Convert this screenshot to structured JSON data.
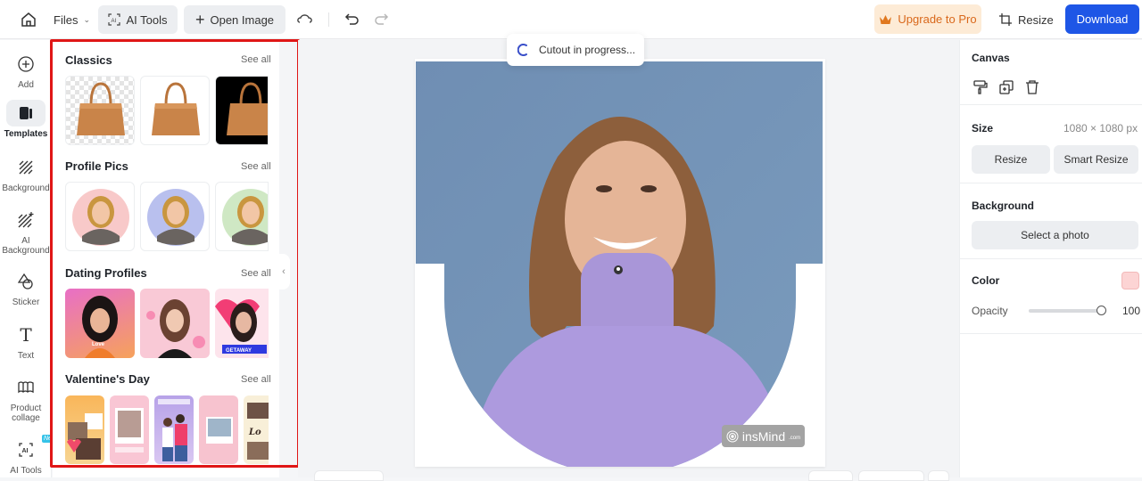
{
  "topbar": {
    "files_label": "Files",
    "ai_tools_label": "AI Tools",
    "open_image_label": "Open Image",
    "upgrade_label": "Upgrade to Pro",
    "resize_label": "Resize",
    "download_label": "Download",
    "colors": {
      "accent": "#1e56e6",
      "upgrade_bg": "#fdebd6",
      "upgrade_text": "#d9681b"
    }
  },
  "rail": {
    "items": [
      {
        "label": "Add",
        "icon": "plus-circle-icon"
      },
      {
        "label": "Templates",
        "icon": "templates-icon",
        "active": true
      },
      {
        "label": "Background",
        "icon": "background-icon"
      },
      {
        "label": "AI Background",
        "icon": "ai-background-icon"
      },
      {
        "label": "Sticker",
        "icon": "sticker-icon"
      },
      {
        "label": "Text",
        "icon": "text-icon"
      },
      {
        "label": "Product collage",
        "icon": "collage-icon"
      },
      {
        "label": "AI Tools",
        "icon": "ai-tools-icon",
        "badge": "New"
      }
    ]
  },
  "templates": {
    "see_all_label": "See all",
    "sections": [
      {
        "title": "Classics",
        "thumbs": [
          "Bag on transparent background",
          "Bag on white background",
          "Bag on black background"
        ]
      },
      {
        "title": "Profile Pics",
        "thumbs": [
          "Portrait on pink circle",
          "Portrait on blue circle",
          "Portrait on green circle"
        ]
      },
      {
        "title": "Dating Profiles",
        "thumbs": [
          "Love profile",
          "Hearts profile",
          "Romantic Getaway profile"
        ],
        "thumb_texts": [
          "Love",
          "",
          "GETAWAY"
        ]
      },
      {
        "title": "Valentine's Day",
        "thumbs": [
          "Valentine collage",
          "Happy Valentine's Day",
          "My Valentine",
          "Lovely memories",
          "Love collage"
        ]
      }
    ]
  },
  "canvas": {
    "toast_text": "Cutout in progress...",
    "watermark_text": "insMind",
    "watermark_suffix": ".com"
  },
  "right_panel": {
    "canvas_title": "Canvas",
    "size_label": "Size",
    "size_value": "1080 × 1080 px",
    "resize_button": "Resize",
    "smart_resize_button": "Smart Resize",
    "background_label": "Background",
    "select_photo_button": "Select a photo",
    "color_label": "Color",
    "color_value": "#fcd4d4",
    "opacity_label": "Opacity",
    "opacity_value": "100"
  }
}
